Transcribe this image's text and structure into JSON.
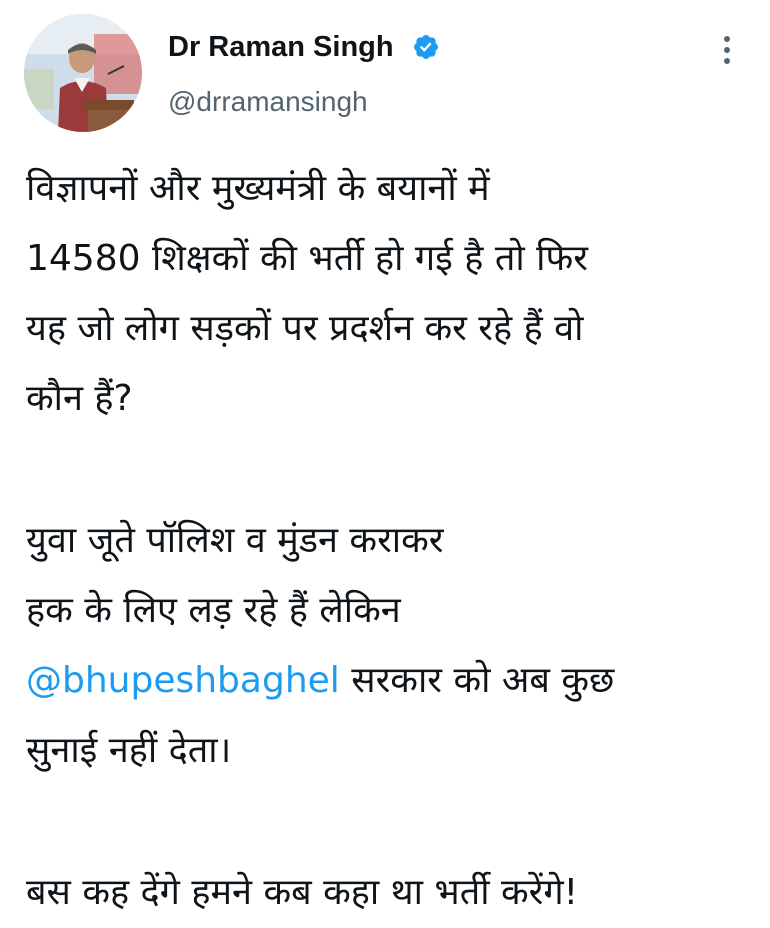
{
  "author": {
    "display_name": "Dr Raman Singh",
    "handle": "@drramansingh",
    "verified": true,
    "avatar_icon": "profile-photo"
  },
  "colors": {
    "link": "#1d9bf0",
    "verified_badge": "#1d9bf0",
    "secondary_text": "#536471",
    "primary_text": "#0f1419"
  },
  "menu": {
    "icon": "more-vertical-icon"
  },
  "tweet": {
    "p1": {
      "l1": "विज्ञापनों और मुख्यमंत्री के बयानों में",
      "l2": "14580 शिक्षकों की भर्ती हो गई है तो फिर",
      "l3": "यह जो लोग सड़कों पर प्रदर्शन कर रहे हैं वो",
      "l4": "कौन हैं?"
    },
    "p2": {
      "l1": "युवा जूते पॉलिश व मुंडन कराकर",
      "l2": "हक के लिए लड़ रहे हैं लेकिन",
      "mention": "@bhupeshbaghel",
      "l3_rest": " सरकार को अब कुछ",
      "l4": "सुनाई नहीं देता।"
    },
    "p3": {
      "l1": "बस कह देंगे हमने कब कहा था भर्ती करेंगे!"
    }
  }
}
